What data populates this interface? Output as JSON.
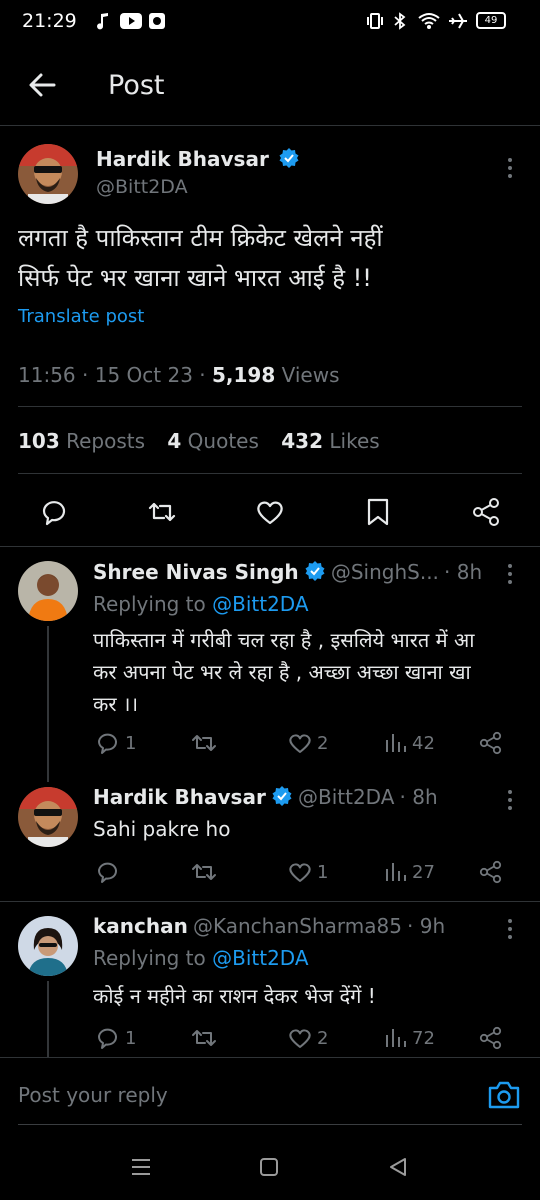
{
  "status_bar": {
    "time": "21:29",
    "battery": "49"
  },
  "header": {
    "title": "Post"
  },
  "main_post": {
    "author_name": "Hardik Bhavsar",
    "handle": "@Bitt2DA",
    "text_line1": "लगता है पाकिस्तान टीम क्रिकेट खेलने नहीं",
    "text_line2": "सिर्फ पेट भर खाना खाने भारत आई है !!",
    "translate_label": "Translate post",
    "time": "11:56",
    "date": "15 Oct 23",
    "views_count": "5,198",
    "views_label": "Views",
    "reposts_count": "103",
    "reposts_label": "Reposts",
    "quotes_count": "4",
    "quotes_label": "Quotes",
    "likes_count": "432",
    "likes_label": "Likes"
  },
  "replies": [
    {
      "name": "Shree Nivas Singh",
      "handle": "@SinghS...",
      "age": "· 8h",
      "replying_prefix": "Replying to",
      "replying_handle": "@Bitt2DA",
      "text_lines": [
        "पाकिस्तान में गरीबी चल रहा है , इसलिये भारत में आ",
        "कर अपना पेट भर ले रहा है , अच्छा अच्छा खाना खा",
        "कर ।।"
      ],
      "replies": "1",
      "likes": "2",
      "views": "42"
    },
    {
      "name": "Hardik Bhavsar",
      "handle": "@Bitt2DA",
      "age": "· 8h",
      "text_lines": [
        "Sahi pakre ho"
      ],
      "replies": "",
      "likes": "1",
      "views": "27"
    },
    {
      "name": "kanchan",
      "handle": "@KanchanSharma85",
      "age": "· 9h",
      "replying_prefix": "Replying to",
      "replying_handle": "@Bitt2DA",
      "text_lines": [
        "कोई न महीने का राशन देकर भेज देंगें !"
      ],
      "replies": "1",
      "likes": "2",
      "views": "72"
    }
  ],
  "reply_bar": {
    "placeholder": "Post your reply"
  },
  "colors": {
    "accent": "#1d9bf0",
    "muted": "#71767b",
    "background": "#000000"
  }
}
